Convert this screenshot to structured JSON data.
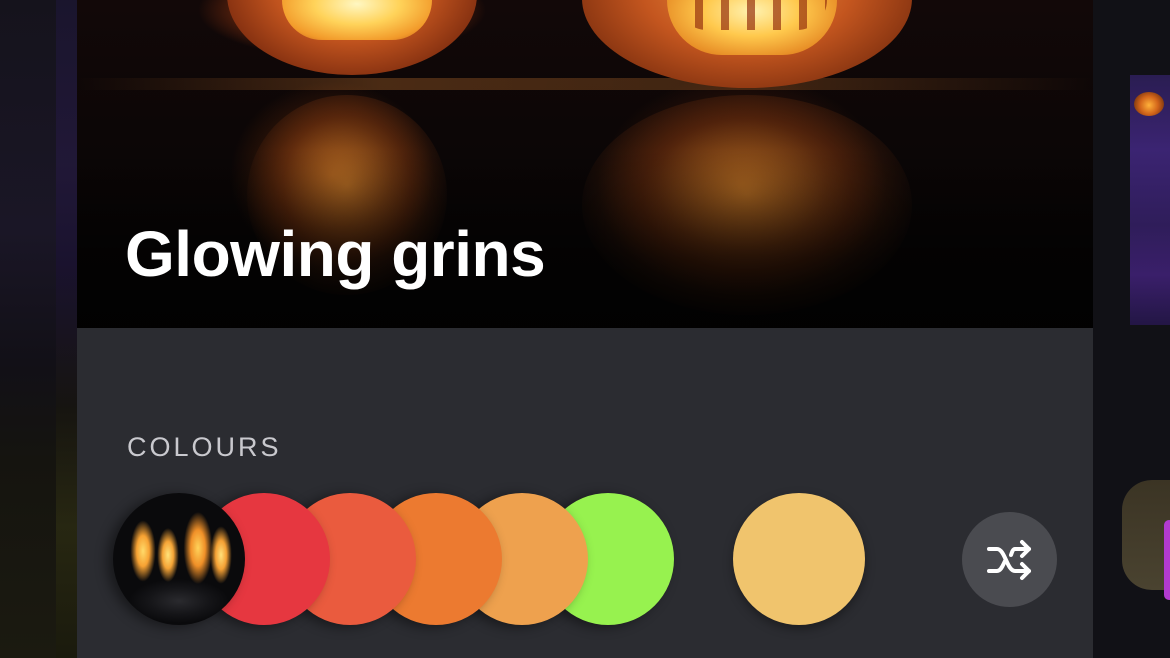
{
  "card": {
    "title": "Glowing grins"
  },
  "colours": {
    "label": "COLOURS",
    "swatches": [
      {
        "type": "photo",
        "description_icon": "fire-photo"
      },
      {
        "type": "color",
        "hex": "#e63740"
      },
      {
        "type": "color",
        "hex": "#ea5b3e"
      },
      {
        "type": "color",
        "hex": "#ec7a30"
      },
      {
        "type": "color",
        "hex": "#eea14e"
      },
      {
        "type": "color",
        "hex": "#97f24f"
      }
    ],
    "selected_color": "#f0c46d",
    "shuffle_icon": "shuffle-icon"
  },
  "theme": {
    "card_background": "#2b2c31",
    "shuffle_background": "#4a4b50",
    "title_color": "#ffffff",
    "label_color": "#c9c9ce"
  }
}
